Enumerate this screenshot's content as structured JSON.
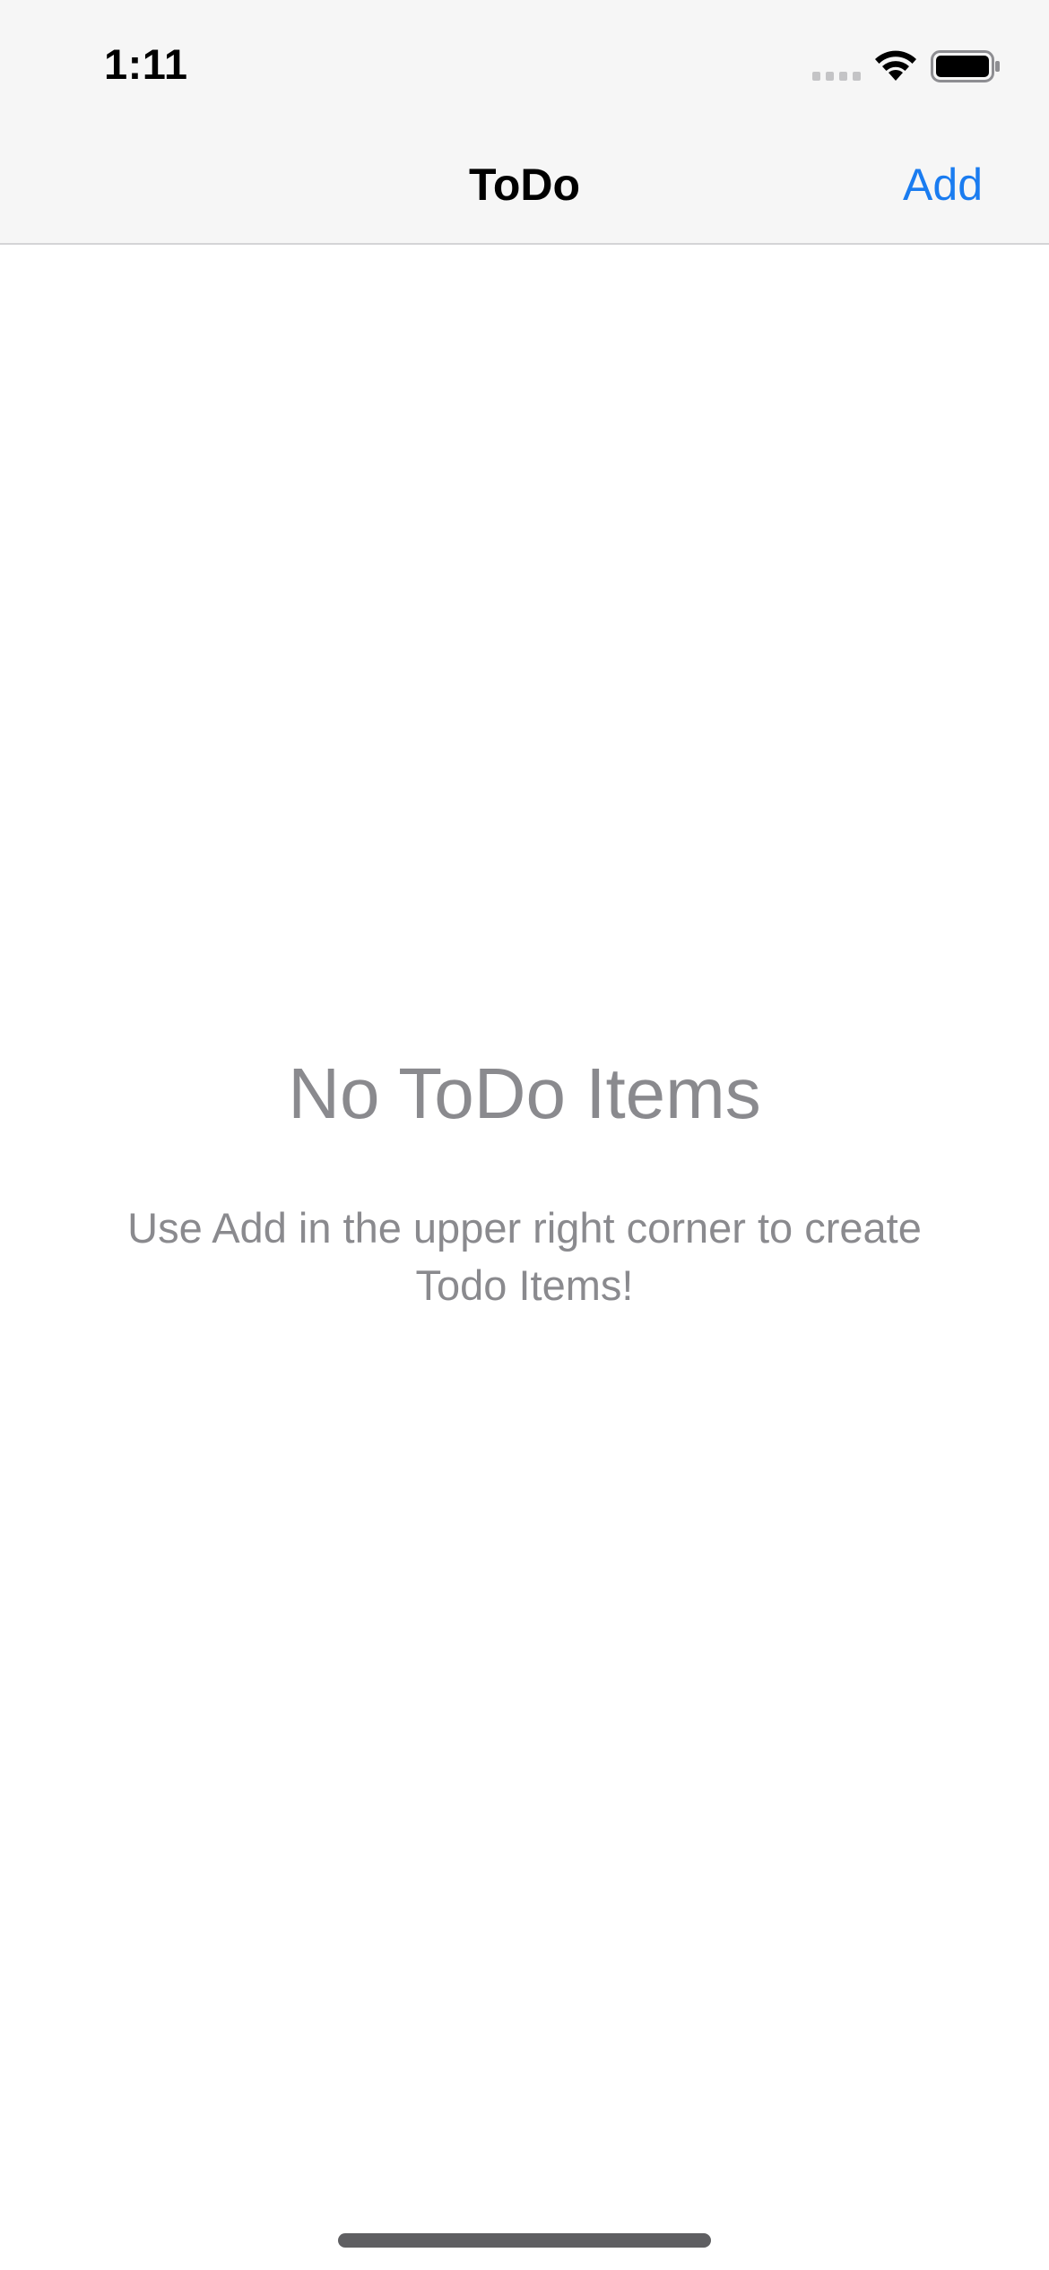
{
  "status_bar": {
    "time": "1:11",
    "icons": [
      "signal-icon",
      "wifi-icon",
      "battery-icon"
    ]
  },
  "nav_bar": {
    "title": "ToDo",
    "add_label": "Add"
  },
  "empty_state": {
    "title": "No ToDo Items",
    "message": "Use Add in the upper right corner to create Todo Items!"
  },
  "colors": {
    "accent": "#1a7cf0",
    "secondary_text": "#8a8a8e",
    "nav_background": "#f6f6f6",
    "separator": "#d4d4d6"
  }
}
